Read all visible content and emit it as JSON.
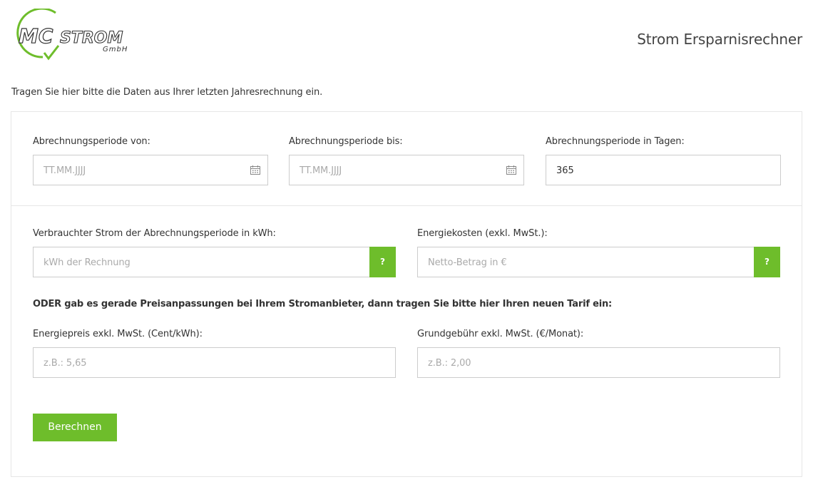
{
  "header": {
    "logo": {
      "word1": "MC",
      "word2": "STROM",
      "suffix": "GmbH"
    },
    "title": "Strom Ersparnisrechner"
  },
  "intro": "Tragen Sie hier bitte die Daten aus Ihrer letzten Jahresrechnung ein.",
  "period": {
    "from": {
      "label": "Abrechnungsperiode von:",
      "placeholder": "TT.MM.JJJJ",
      "icon": "calendar-icon"
    },
    "to": {
      "label": "Abrechnungsperiode bis:",
      "placeholder": "TT.MM.JJJJ",
      "icon": "calendar-icon"
    },
    "days": {
      "label": "Abrechnungsperiode in Tagen:",
      "value": "365"
    }
  },
  "consumption": {
    "kwh": {
      "label": "Verbrauchter Strom der Abrechnungsperiode in kWh:",
      "placeholder": "kWh der Rechnung",
      "help": "?"
    },
    "cost": {
      "label": "Energiekosten (exkl. MwSt.):",
      "placeholder": "Netto-Betrag in €",
      "help": "?"
    }
  },
  "notice": "ODER gab es gerade Preisanpassungen bei Ihrem Stromanbieter, dann tragen Sie bitte hier Ihren neuen Tarif ein:",
  "tariff": {
    "price": {
      "label": "Energiepreis exkl. MwSt. (Cent/kWh):",
      "placeholder": "z.B.: 5,65"
    },
    "fee": {
      "label": "Grundgebühr exkl. MwSt. (€/Monat):",
      "placeholder": "z.B.: 2,00"
    }
  },
  "submit_label": "Berechnen",
  "colors": {
    "accent": "#6ebd2b",
    "border": "#cccccc",
    "panel_border": "#e6e6e6",
    "text": "#333333",
    "placeholder": "#aaaaaa"
  }
}
